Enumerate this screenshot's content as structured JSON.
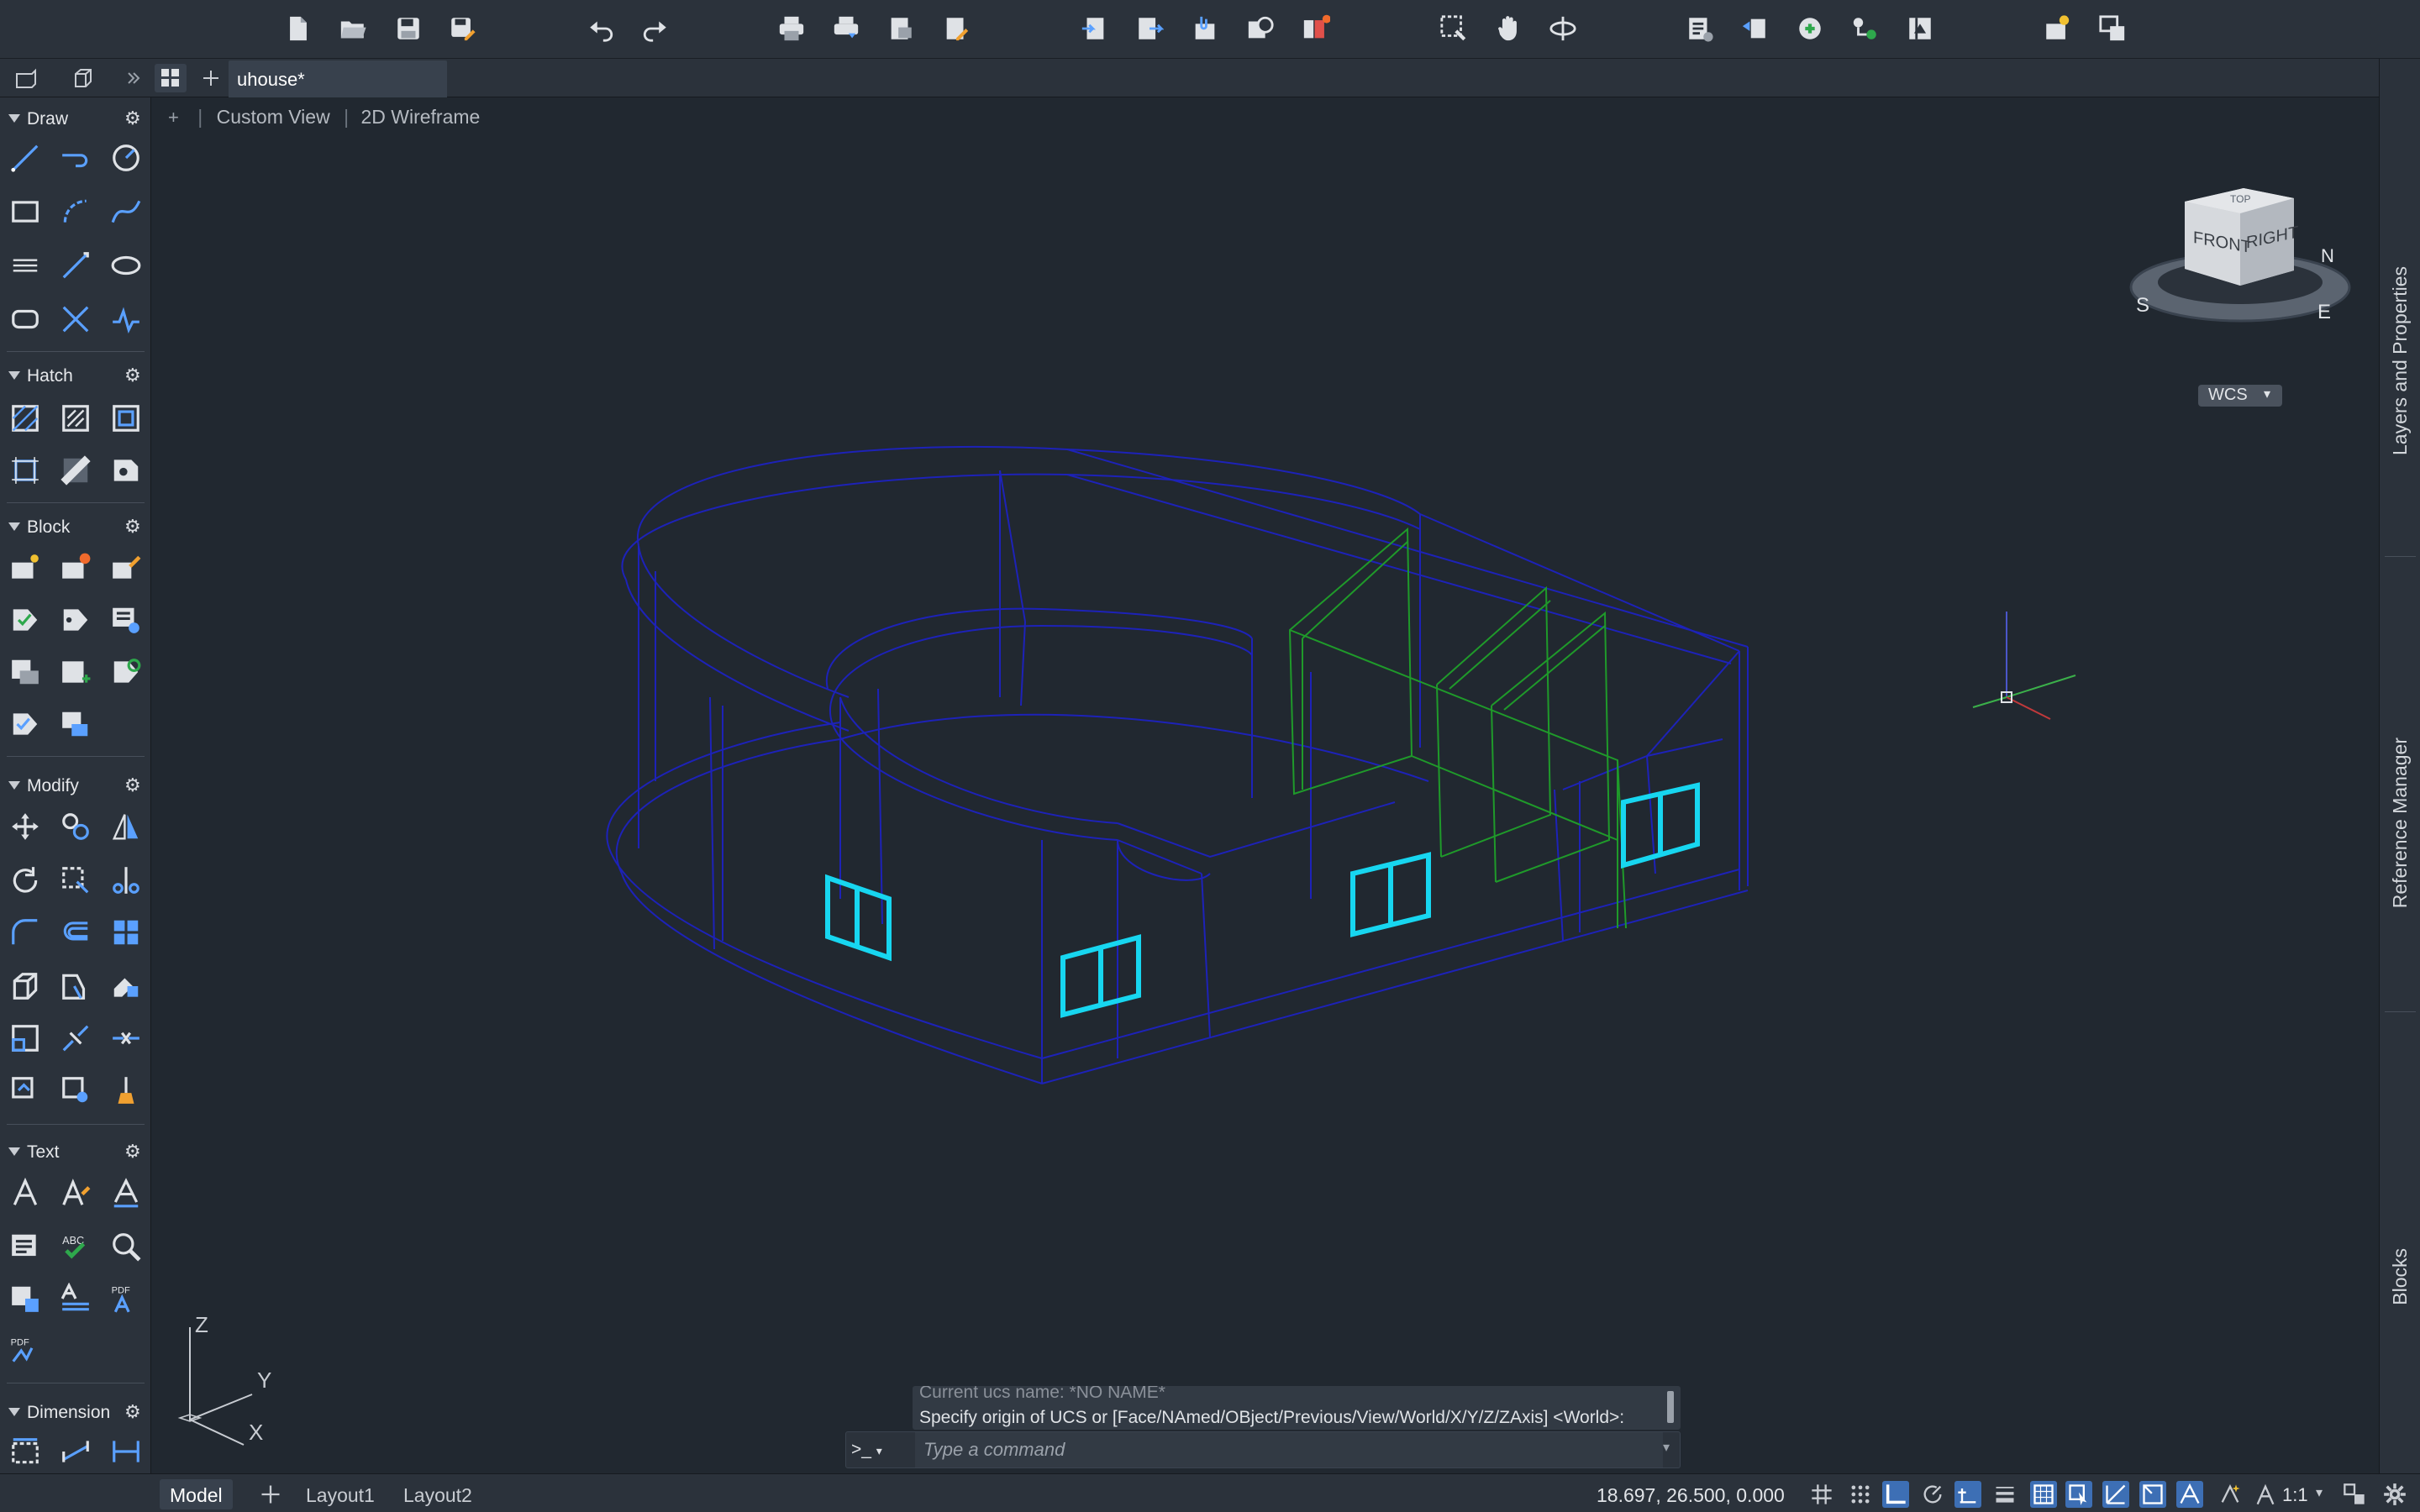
{
  "document": {
    "tab_title": "uhouse*"
  },
  "viewport": {
    "view_name": "Custom View",
    "visual_style": "2D Wireframe",
    "ucs_label": "WCS",
    "viewcube_faces": [
      "FRONT",
      "RIGHT",
      "TOP"
    ],
    "compass_letters": [
      "S",
      "E",
      "N"
    ]
  },
  "palette": {
    "sections": [
      {
        "label": "Draw"
      },
      {
        "label": "Hatch"
      },
      {
        "label": "Block"
      },
      {
        "label": "Modify"
      },
      {
        "label": "Text"
      },
      {
        "label": "Dimension"
      }
    ]
  },
  "right_panel": {
    "tabs": [
      "Layers and Properties",
      "Reference Manager",
      "Blocks"
    ]
  },
  "command_line": {
    "previous_line": "Current ucs name:  *NO NAME*",
    "last_line": "Specify origin of UCS or [Face/NAmed/OBject/Previous/View/World/X/Y/Z/ZAxis] <World>:",
    "prompt_symbol": ">_",
    "placeholder": "Type a command"
  },
  "status_bar": {
    "layout_tabs": [
      "Model",
      "Layout1",
      "Layout2"
    ],
    "coordinates": "18.697, 26.500, 0.000",
    "annotation_scale": "1:1"
  },
  "axis_labels": {
    "x": "X",
    "y": "Y",
    "z": "Z"
  },
  "colors": {
    "background": "#212830",
    "panel": "#2b323b",
    "wireframe_blue": "#1d22b8",
    "wireframe_green": "#1f9a2a",
    "window_cyan": "#17d6f0",
    "notification": "#f06a2c"
  }
}
